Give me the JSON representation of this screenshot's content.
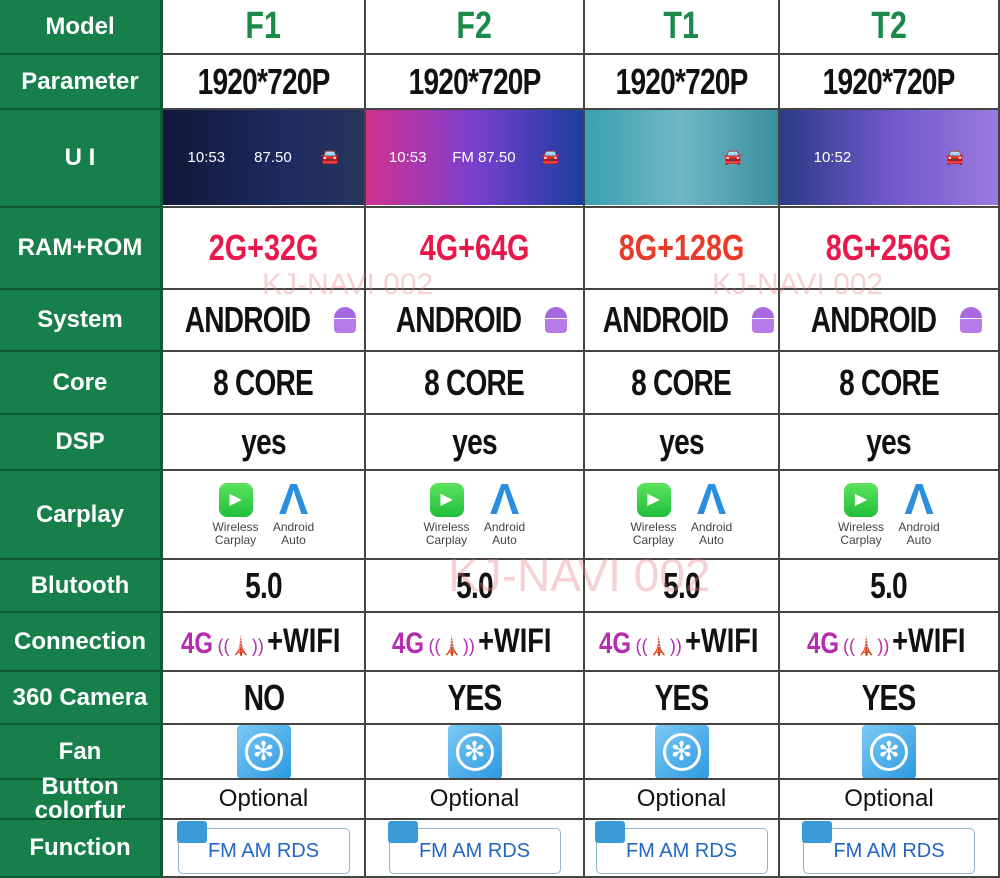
{
  "labels": [
    "Model",
    "Parameter",
    "U I",
    "RAM+ROM",
    "System",
    "Core",
    "DSP",
    "Carplay",
    "Blutooth",
    "Connection",
    "360 Camera",
    "Fan",
    "Button colorfur",
    "Function"
  ],
  "models": [
    {
      "name": "F1",
      "resolution": "1920*720P",
      "ui_time": "10:53",
      "ui_extra": "87.50",
      "ram": "2G+32G",
      "ram_color": "#e8194a",
      "system": "ANDROID",
      "core": "8 CORE",
      "dsp": "yes",
      "carplay": "Wireless Carplay",
      "android_auto": "Android Auto",
      "bluetooth": "5.0",
      "conn_4g": "4G",
      "conn_wifi": "+WIFI",
      "camera": "NO",
      "button": "Optional",
      "function": "FM AM RDS"
    },
    {
      "name": "F2",
      "resolution": "1920*720P",
      "ui_time": "10:53",
      "ui_extra": "FM 87.50",
      "ram": "4G+64G",
      "ram_color": "#e8194a",
      "system": "ANDROID",
      "core": "8 CORE",
      "dsp": "yes",
      "carplay": "Wireless Carplay",
      "android_auto": "Android Auto",
      "bluetooth": "5.0",
      "conn_4g": "4G",
      "conn_wifi": "+WIFI",
      "camera": "YES",
      "button": "Optional",
      "function": "FM AM RDS"
    },
    {
      "name": "T1",
      "resolution": "1920*720P",
      "ui_time": "",
      "ui_extra": "",
      "ram": "8G+128G",
      "ram_color": "#e83a2a",
      "system": "ANDROID",
      "core": "8 CORE",
      "dsp": "yes",
      "carplay": "Wireless Carplay",
      "android_auto": "Android Auto",
      "bluetooth": "5.0",
      "conn_4g": "4G",
      "conn_wifi": "+WIFI",
      "camera": "YES",
      "button": "Optional",
      "function": "FM AM RDS"
    },
    {
      "name": "T2",
      "resolution": "1920*720P",
      "ui_time": "10:52",
      "ui_extra": "",
      "ram": "8G+256G",
      "ram_color": "#e8194a",
      "system": "ANDROID",
      "core": "8 CORE",
      "dsp": "yes",
      "carplay": "Wireless Carplay",
      "android_auto": "Android Auto",
      "bluetooth": "5.0",
      "conn_4g": "4G",
      "conn_wifi": "+WIFI",
      "camera": "YES",
      "button": "Optional",
      "function": "FM AM RDS"
    }
  ],
  "watermark": "KJ-NAVI 002",
  "colors": {
    "label_bg": "#17804a",
    "model_text": "#1a8a48",
    "conn_4g": "#b52cb0",
    "function_text": "#2166c2"
  },
  "icons": {
    "system": "android-robot-icon",
    "carplay": "carplay-icon",
    "android_auto": "android-auto-icon",
    "connection": "cell-tower-icon",
    "fan": "fan-icon",
    "function": "radio-icon"
  }
}
